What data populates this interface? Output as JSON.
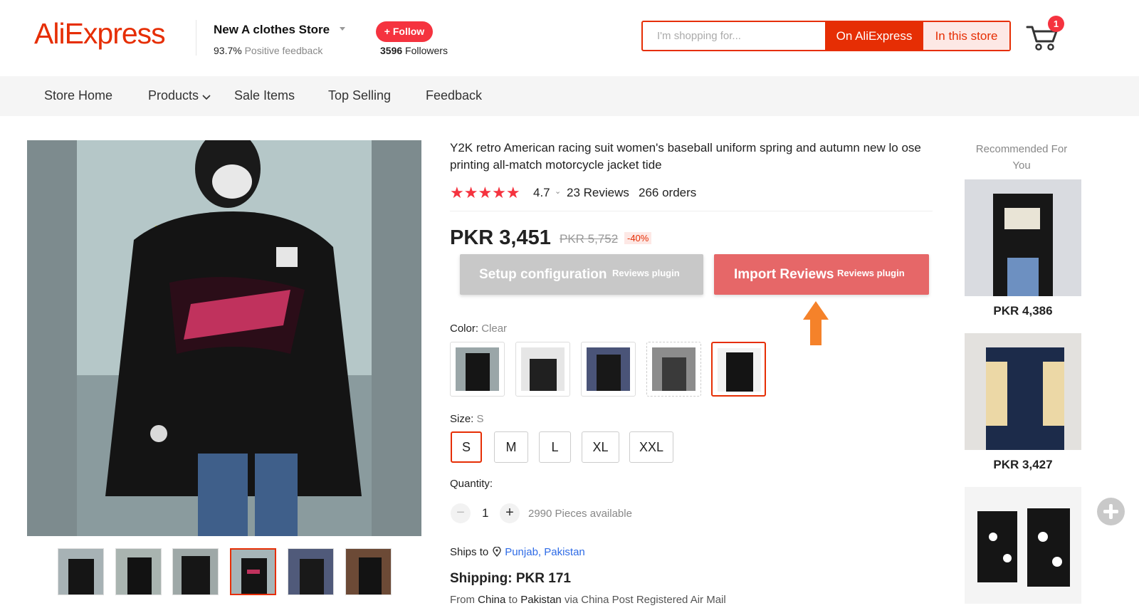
{
  "header": {
    "logo": "AliExpress",
    "store_name": "New A clothes Store",
    "feedback_pct": "93.7%",
    "feedback_label": "Positive feedback",
    "follow_label": "+ Follow",
    "followers_count": "3596",
    "followers_label": "Followers",
    "search_placeholder": "I'm shopping for...",
    "search_on_aliexpress": "On AliExpress",
    "search_in_store": "In this store",
    "cart_count": "1"
  },
  "nav": {
    "items": [
      "Store Home",
      "Products",
      "Sale Items",
      "Top Selling",
      "Feedback"
    ]
  },
  "product": {
    "title": "Y2K retro American racing suit women's baseball uniform spring and autumn new lo ose printing all-match motorcycle jacket tide",
    "stars": "★★★★★",
    "rating": "4.7",
    "rating_value": 4.7,
    "reviews": "23 Reviews",
    "orders": "266 orders",
    "price": "PKR 3,451",
    "old_price": "PKR 5,752",
    "discount": "-40%",
    "setup_btn": "Setup configuration",
    "setup_sub": "Reviews plugin",
    "import_btn": "Import Reviews",
    "import_sub": "Reviews plugin",
    "color_label": "Color:",
    "color_value": "Clear",
    "size_label": "Size:",
    "size_value": "S",
    "sizes": [
      "S",
      "M",
      "L",
      "XL",
      "XXL"
    ],
    "quantity_label": "Quantity:",
    "quantity_minus": "−",
    "quantity_plus": "+",
    "quantity": "1",
    "available": "2990 Pieces available",
    "ships_to_label": "Ships to",
    "ships_to_location": "Punjab, Pakistan",
    "shipping": "Shipping: PKR 171",
    "from_prefix": "From",
    "from_country": "China",
    "to_prefix": "to",
    "to_country": "Pakistan",
    "via": "via China Post Registered Air Mail"
  },
  "recommended": {
    "title": "Recommended For You",
    "items": [
      {
        "price": "PKR 4,386"
      },
      {
        "price": "PKR 3,427"
      }
    ]
  },
  "colors": {
    "brand": "#e62e04",
    "follow": "#f5333f",
    "import_button": "#e66768",
    "setup_button": "#c8c8c8",
    "arrow": "#f5822a",
    "link": "#2e6be6"
  }
}
